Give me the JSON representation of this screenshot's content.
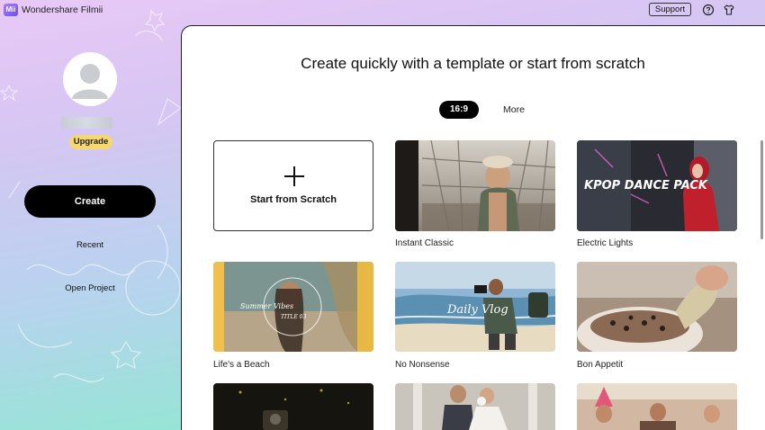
{
  "titlebar": {
    "logo_text": "Mii",
    "app_name": "Wondershare Filmii",
    "support_label": "Support",
    "icons": [
      "help-icon",
      "shirt-theme-icon"
    ]
  },
  "sidebar": {
    "upgrade_label": "Upgrade",
    "create_label": "Create",
    "recent_label": "Recent",
    "open_project_label": "Open Project"
  },
  "main": {
    "headline": "Create quickly with a template or start from scratch",
    "tabs": [
      {
        "label": "16:9",
        "selected": true
      },
      {
        "label": "More",
        "selected": false
      }
    ],
    "scratch_label": "Start from Scratch",
    "templates": [
      {
        "label": "Instant Classic",
        "overlay": ""
      },
      {
        "label": "Electric Lights",
        "overlay": "KPOP DANCE PACK"
      },
      {
        "label": "Life's a Beach",
        "overlay": "Summer Vibes",
        "overlay2": "TITLE 03"
      },
      {
        "label": "No Nonsense",
        "overlay": "Daily Vlog"
      },
      {
        "label": "Bon Appetit",
        "overlay": ""
      }
    ]
  },
  "colors": {
    "accent": "#000000",
    "upgrade_badge": "#f6d770",
    "gradient_top": "#e9c8f6",
    "gradient_bottom": "#8ee9cf"
  }
}
